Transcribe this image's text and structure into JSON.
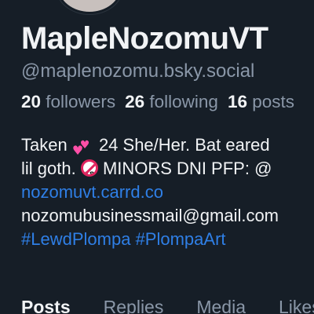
{
  "profile": {
    "display_name": "MapleNozomuVT",
    "handle": "@maplenozomu.bsky.social"
  },
  "stats": {
    "followers_count": "20",
    "followers_label": "followers",
    "following_count": "26",
    "following_label": "following",
    "posts_count": "16",
    "posts_label": "posts"
  },
  "bio": {
    "line1_before": "Taken ",
    "line1_after": " 24 She/Her. Bat eared",
    "line2_before": "lil goth. ",
    "line2_after": " MINORS DNI PFP: @",
    "age_badge_text": "18",
    "link": "nozomuvt.carrd.co",
    "email": "nozomubusinessmail@gmail.com",
    "hashtag1": "#LewdPlompa",
    "hashtag2": "#PlompaArt",
    "emoji1": "two-hearts-icon",
    "emoji2": "no-one-under-eighteen-icon"
  },
  "tabs": [
    {
      "label": "Posts",
      "active": true
    },
    {
      "label": "Replies",
      "active": false
    },
    {
      "label": "Media",
      "active": false
    },
    {
      "label": "Likes",
      "active": false
    }
  ],
  "colors": {
    "background": "#161e27",
    "text": "#f1f3f5",
    "muted": "#8a97a8",
    "link": "#2f7fe6"
  }
}
